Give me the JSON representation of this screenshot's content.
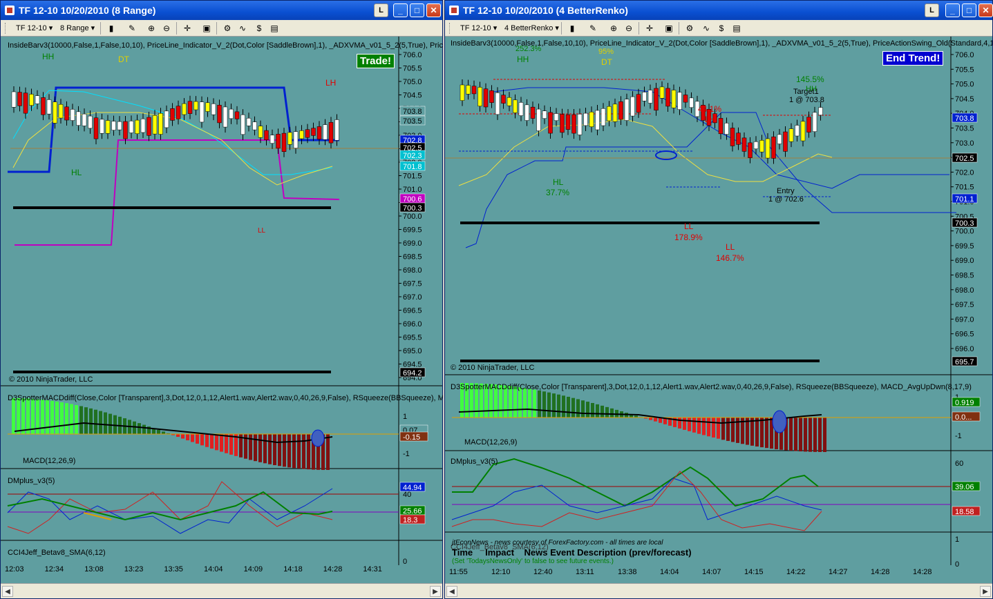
{
  "left": {
    "title": "TF 12-10  10/20/2010 (8 Range)",
    "instrument": "TF 12-10",
    "period": "8 Range",
    "indicators_line": "InsideBarv3(10000,False,1,False,10,10),  PriceLine_Indicator_V_2(Dot,Color [SaddleBrown],1),  _ADXVMA_v01_5_2(5,True),  Pric",
    "signal": "Trade!",
    "copyright": "© 2010 NinjaTrader, LLC",
    "labels": {
      "hh": "HH",
      "dt": "DT",
      "hl": "HL",
      "lh": "LH",
      "ll": "LL"
    },
    "price_ticks": [
      "706.0",
      "705.5",
      "705.0",
      "704.5",
      "704.0",
      "703.5",
      "703.0",
      "702.5",
      "702.0",
      "701.5",
      "701.0",
      "700.5",
      "700.0",
      "699.5",
      "699.0",
      "698.5",
      "698.0",
      "697.5",
      "697.0",
      "696.5",
      "696.0",
      "695.5",
      "695.0",
      "694.5",
      "694.0"
    ],
    "price_tags": [
      "703.8",
      "703.5",
      "702.8",
      "702.5",
      "702.3",
      "701.8",
      "700.6",
      "700.3",
      "694.2"
    ],
    "macd_line": "D3SpotterMACDdiff(Close,Color [Transparent],3,Dot,12,0,1,12,Alert1.wav,Alert2.wav,0,40,26,9,False), RSqueeze(BBSqueeze), M",
    "macd_label": "MACD(12,26,9)",
    "macd_ticks": [
      "1",
      "-1"
    ],
    "macd_tags": [
      "0.07",
      "-0.15"
    ],
    "dm_label": "DMplus_v3(5)",
    "dm_ticks": [
      "40"
    ],
    "dm_tags": [
      "44.94",
      "25.66",
      "18.3"
    ],
    "cci_label": "CCI4Jeff_Betav8_SMA(6,12)",
    "cci_ticks": [
      "0"
    ],
    "time_ticks": [
      "12:03",
      "12:34",
      "13:08",
      "13:23",
      "13:35",
      "14:04",
      "14:09",
      "14:18",
      "14:28",
      "14:31"
    ]
  },
  "right": {
    "title": "TF 12-10  10/20/2010 (4 BetterRenko)",
    "instrument": "TF 12-10",
    "period": "4 BetterRenko",
    "indicators_line": "InsideBarv3(10000,False,1,False,10,10),  PriceLine_Indicator_V_2(Dot,Color [SaddleBrown],1),  _ADXVMA_v01_5_2(5,True),  PriceActionSwing_Old(Standard,4,1",
    "signal": "End Trend!",
    "copyright": "© 2010 NinjaTrader, LLC",
    "labels": {
      "hh": "HH",
      "hh_pct": "252.3%",
      "dt": "DT",
      "dt_pct": "95%",
      "hl": "HL",
      "hl_pct": "37.7%",
      "lh": "LH",
      "lh_pct": "44.1%",
      "hh2": "HH",
      "hh2_pct": "145.5%",
      "ll": "LL",
      "ll_pct": "178.9%",
      "ll2": "LL",
      "ll2_pct": "146.7%",
      "target": "Target1",
      "target_price": "1 @ 703.8",
      "entry": "Entry",
      "entry_price": "1 @ 702.6"
    },
    "price_ticks": [
      "706.0",
      "705.5",
      "705.0",
      "704.5",
      "704.0",
      "703.5",
      "703.0",
      "702.5",
      "702.0",
      "701.5",
      "701.0",
      "700.5",
      "700.0",
      "699.5",
      "699.0",
      "698.5",
      "698.0",
      "697.5",
      "697.0",
      "696.5",
      "696.0"
    ],
    "price_tags": [
      "703.8",
      "702.5",
      "701.1",
      "700.3",
      "695.7"
    ],
    "macd_line": "D3SpotterMACDdiff(Close,Color [Transparent],3,Dot,12,0,1,12,Alert1.wav,Alert2.wav,0,40,26,9,False), RSqueeze(BBSqueeze), MACD_AvgUpDwn(8,17,9)",
    "macd_label": "MACD(12,26,9)",
    "macd_ticks": [
      "1",
      "-1"
    ],
    "macd_tags": [
      "0.919",
      "0.0..."
    ],
    "dm_label": "DMplus_v3(5)",
    "dm_ticks": [
      "60",
      "40"
    ],
    "dm_tags": [
      "39.06",
      "18.58"
    ],
    "cci_label": "CCI4Jeff_Betav8_SMA(6,12)",
    "cci_ticks": [
      "1",
      "0"
    ],
    "news_source": "jtEconNews - news courtesy of ForexFactory.com - all times are local",
    "news_header": "Time     Impact    News Event Description (prev/forecast)",
    "news_hint": "(Set 'TodaysNewsOnly' to false to see future events.)",
    "time_ticks": [
      "11:55",
      "12:10",
      "12:40",
      "13:11",
      "13:38",
      "14:04",
      "14:07",
      "14:15",
      "14:22",
      "14:27",
      "14:28",
      "14:28"
    ]
  },
  "colors": {
    "chart_bg": "#5f9ea0",
    "up": "#ffffff",
    "down": "#e00000",
    "inside": "#ffff00",
    "green": "#008000",
    "ma_blue": "#0020d0",
    "ma_magenta": "#c000c0",
    "black_line": "#000000"
  }
}
